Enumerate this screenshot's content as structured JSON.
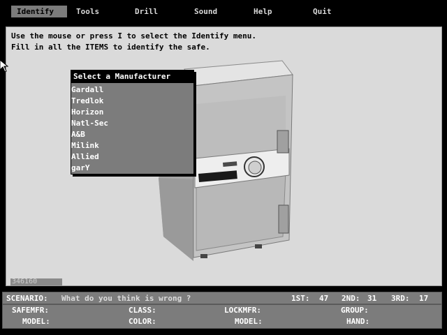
{
  "menu": {
    "items": [
      {
        "label": "Identify",
        "active": true
      },
      {
        "label": "Tools"
      },
      {
        "label": "Drill"
      },
      {
        "label": "Sound"
      },
      {
        "label": "Help"
      },
      {
        "label": "Quit"
      }
    ]
  },
  "instructions": {
    "line1": "Use the mouse or press I to select the Identify menu.",
    "line2": "Fill in all the ITEMS to identify the safe."
  },
  "dropdown": {
    "title": "Select a Manufacturer",
    "options": [
      "Gardall",
      "Tredlok",
      "Horizon",
      "Natl-Sec",
      "A&B",
      "Milink",
      "Allied",
      "garY"
    ]
  },
  "serial": "346160",
  "scenario": {
    "label": "SCENARIO:",
    "question": "What do you think is wrong ?",
    "scores": {
      "first_label": "1ST:",
      "first": "47",
      "second_label": "2ND:",
      "second": "31",
      "third_label": "3RD:",
      "third": "17"
    }
  },
  "fields": {
    "row1": [
      "SAFEMFR:",
      "CLASS:",
      "LOCKMFR:",
      "GROUP:"
    ],
    "row2": [
      "MODEL:",
      "COLOR:",
      "MODEL:",
      "HAND:"
    ]
  },
  "colors": {
    "panel": "#dadada",
    "bar": "#7c7c7c",
    "text_light": "#ffffff"
  }
}
